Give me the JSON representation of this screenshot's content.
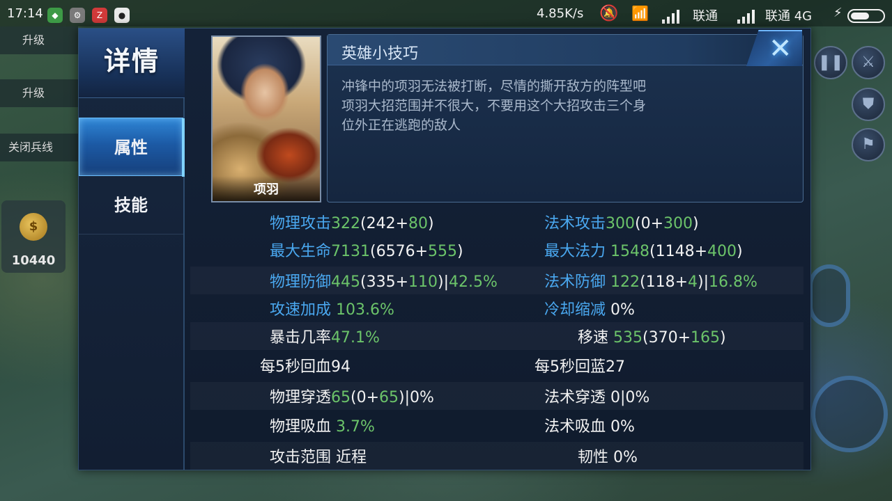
{
  "status_bar": {
    "time": "17:14",
    "net_speed": "4.85K/s",
    "carrier1": "联通",
    "carrier2": "联通 4G",
    "icons": [
      "app-icon-green",
      "app-icon-gray",
      "app-icon-red",
      "qq-penguin-icon",
      "mute-icon",
      "wifi-icon",
      "signal-icon",
      "bolt-icon",
      "battery-icon"
    ]
  },
  "background": {
    "left_menu": [
      "升级",
      "升级",
      "关闭兵线"
    ],
    "gold_amount": "10440",
    "gold_symbol": "$"
  },
  "dialog": {
    "title": "详情",
    "tabs": [
      {
        "label": "属性",
        "active": true
      },
      {
        "label": "技能",
        "active": false
      }
    ],
    "close_icon": "✕",
    "hero": {
      "name": "项羽"
    },
    "tips": {
      "title": "英雄小技巧",
      "lines": [
        "冲锋中的项羽无法被打断，尽情的撕开敌方的阵型吧",
        "项羽大招范围并不很大，不要用这个大招攻击三个身",
        "位外正在逃跑的敌人"
      ]
    },
    "stats": [
      {
        "left": {
          "label": "物理攻击",
          "blue": true,
          "parts": [
            [
              "322",
              "g"
            ],
            [
              "(242+",
              "w"
            ],
            [
              "80",
              "g"
            ],
            [
              ")",
              "w"
            ]
          ]
        },
        "right": {
          "label": "法术攻击",
          "blue": true,
          "parts": [
            [
              "300",
              "g"
            ],
            [
              "(0+",
              "w"
            ],
            [
              "300",
              "g"
            ],
            [
              ")",
              "w"
            ]
          ]
        }
      },
      {
        "left": {
          "label": "最大生命",
          "blue": true,
          "parts": [
            [
              "7131",
              "g"
            ],
            [
              "(6576+",
              "w"
            ],
            [
              "555",
              "g"
            ],
            [
              ")",
              "w"
            ]
          ]
        },
        "right": {
          "label": "最大法力",
          "blue": true,
          "parts": [
            [
              " 1548",
              "g"
            ],
            [
              "(1148+",
              "w"
            ],
            [
              "400",
              "g"
            ],
            [
              ")",
              "w"
            ]
          ]
        }
      },
      {
        "left": {
          "label": "物理防御",
          "blue": true,
          "parts": [
            [
              "445",
              "g"
            ],
            [
              "(335+",
              "w"
            ],
            [
              "110",
              "g"
            ],
            [
              ")|",
              "w"
            ],
            [
              "42.5%",
              "g"
            ]
          ]
        },
        "right": {
          "label": "法术防御",
          "blue": true,
          "parts": [
            [
              " 122",
              "g"
            ],
            [
              "(118+",
              "w"
            ],
            [
              "4",
              "g"
            ],
            [
              ")|",
              "w"
            ],
            [
              "16.8%",
              "g"
            ]
          ]
        }
      },
      {
        "left": {
          "label": "攻速加成",
          "blue": true,
          "parts": [
            [
              " 103.6%",
              "g"
            ]
          ]
        },
        "right": {
          "label": "冷却缩减",
          "blue": true,
          "parts": [
            [
              " 0%",
              "w"
            ]
          ]
        }
      },
      {
        "left": {
          "label": "暴击几率",
          "blue": false,
          "parts": [
            [
              "47.1%",
              "g"
            ]
          ]
        },
        "right": {
          "label": "移速",
          "blue": false,
          "parts": [
            [
              " 535",
              "g"
            ],
            [
              "(370+",
              "w"
            ],
            [
              "165",
              "g"
            ],
            [
              ")",
              "w"
            ]
          ]
        }
      },
      {
        "left": {
          "label": "每5秒回血",
          "blue": false,
          "parts": [
            [
              "94",
              "w"
            ]
          ]
        },
        "right": {
          "label": "每5秒回蓝",
          "blue": false,
          "parts": [
            [
              "27",
              "w"
            ]
          ]
        }
      },
      {
        "left": {
          "label": "物理穿透",
          "blue": false,
          "parts": [
            [
              "65",
              "g"
            ],
            [
              "(0+",
              "w"
            ],
            [
              "65",
              "g"
            ],
            [
              ")|0%",
              "w"
            ]
          ]
        },
        "right": {
          "label": "法术穿透",
          "blue": false,
          "parts": [
            [
              " 0|0%",
              "w"
            ]
          ]
        }
      },
      {
        "left": {
          "label": "物理吸血",
          "blue": false,
          "parts": [
            [
              " 3.7%",
              "g"
            ]
          ]
        },
        "right": {
          "label": "法术吸血",
          "blue": false,
          "parts": [
            [
              " 0%",
              "w"
            ]
          ]
        }
      },
      {
        "left": {
          "label": "攻击范围",
          "blue": false,
          "parts": [
            [
              " 近程",
              "w"
            ]
          ]
        },
        "right": {
          "label": "韧性",
          "blue": false,
          "parts": [
            [
              " 0%",
              "w"
            ]
          ]
        }
      }
    ]
  },
  "colors": {
    "label_blue": "#4aa8f0",
    "value_green": "#6cc46a",
    "value_white": "#f2f2f2",
    "accent_cyan": "#7fd2ff"
  }
}
